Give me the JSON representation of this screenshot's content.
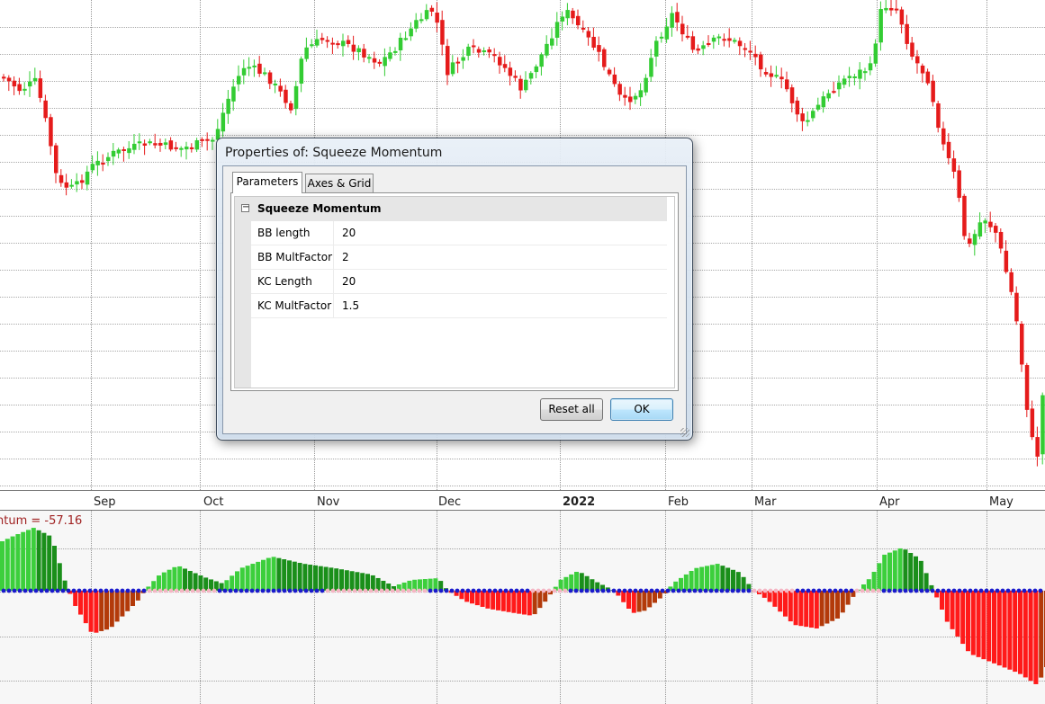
{
  "chart": {
    "month_labels": [
      "Sep",
      "Oct",
      "Nov",
      "Dec",
      "2022",
      "Feb",
      "Mar",
      "Apr",
      "May"
    ],
    "indicator_label": "ntum = -57.16",
    "colors": {
      "up_candle": "#33cc33",
      "down_candle": "#e51b1b",
      "hist_bright_green": "#3ccf3c",
      "hist_dark_green": "#1a8f1a",
      "hist_bright_red": "#ff1a1a",
      "hist_dark_red": "#b33a0a",
      "squeeze_on": "#1a1acc",
      "squeeze_off": "#f5b6c4",
      "grid": "#555555"
    }
  },
  "dialog": {
    "title": "Properties of: Squeeze Momentum",
    "tabs": [
      "Parameters",
      "Axes & Grid"
    ],
    "active_tab": "Parameters",
    "category": "Squeeze Momentum",
    "expander_glyph": "−",
    "properties": [
      {
        "name": "BB length",
        "value": "20"
      },
      {
        "name": "BB MultFactor",
        "value": "2"
      },
      {
        "name": "KC Length",
        "value": "20"
      },
      {
        "name": "KC MultFactor",
        "value": "1.5"
      }
    ],
    "buttons": {
      "reset": "Reset all",
      "ok": "OK"
    }
  }
}
